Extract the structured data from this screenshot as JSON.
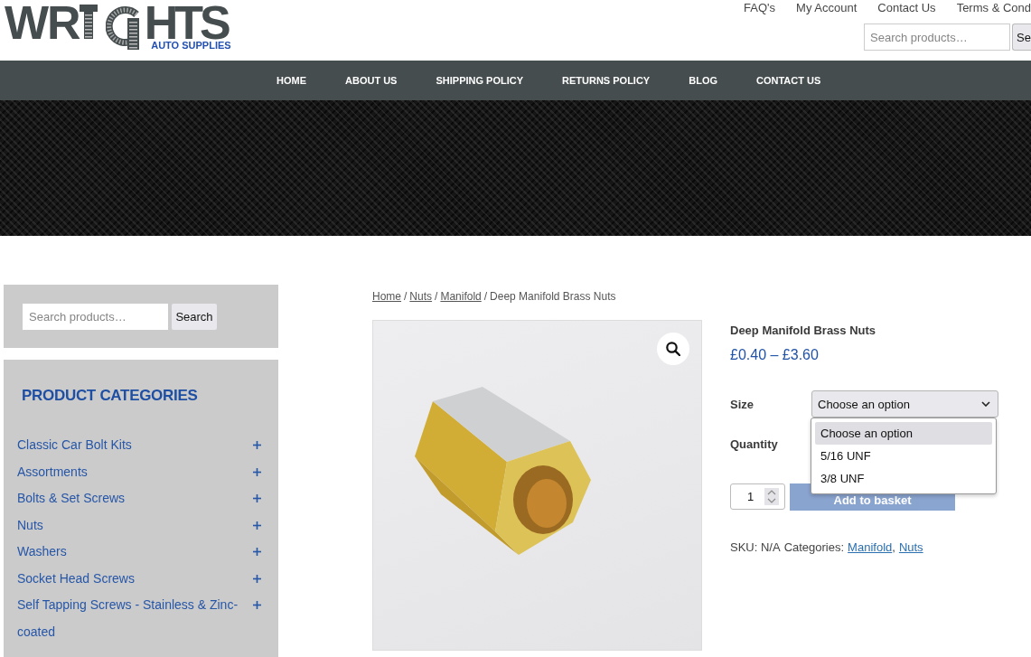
{
  "header": {
    "logo": {
      "text_start": "WR",
      "text_end": "HTS",
      "tagline": "AUTO SUPPLIES"
    },
    "top_links": [
      "FAQ's",
      "My Account",
      "Contact Us",
      "Terms & Cond"
    ],
    "search": {
      "placeholder": "Search products…",
      "button": "Se"
    }
  },
  "nav": [
    "HOME",
    "ABOUT US",
    "SHIPPING POLICY",
    "RETURNS POLICY",
    "BLOG",
    "CONTACT US"
  ],
  "sidebar": {
    "search": {
      "placeholder": "Search products…",
      "button": "Search"
    },
    "categories": {
      "title": "PRODUCT CATEGORIES",
      "items": [
        {
          "label": "Classic Car Bolt Kits",
          "expanded": false
        },
        {
          "label": "Assortments",
          "expanded": false
        },
        {
          "label": "Bolts & Set Screws",
          "expanded": false
        },
        {
          "label": "Nuts",
          "expanded": false
        },
        {
          "label": "Washers",
          "expanded": false
        },
        {
          "label": "Socket Head Screws",
          "expanded": false
        },
        {
          "label": "Self Tapping Screws - Stainless & Zinc-coated",
          "expanded": false
        }
      ]
    }
  },
  "breadcrumb": [
    {
      "label": "Home",
      "kind": "link"
    },
    {
      "label": "/",
      "kind": "separator"
    },
    {
      "label": "Nuts",
      "kind": "link"
    },
    {
      "label": "/",
      "kind": "separator"
    },
    {
      "label": "Manifold",
      "kind": "link"
    },
    {
      "label": "/",
      "kind": "separator"
    },
    {
      "label": "Deep Manifold Brass Nuts",
      "kind": "current"
    }
  ],
  "product": {
    "title": "Deep Manifold Brass Nuts",
    "price": "£0.40 – £3.60",
    "variations": [
      {
        "label": "Size",
        "value": "Choose an option",
        "open": true,
        "options": [
          {
            "label": "Choose an option",
            "selected": true
          },
          {
            "label": "5/16 UNF",
            "selected": false
          },
          {
            "label": "3/8 UNF",
            "selected": false
          }
        ]
      },
      {
        "label": "Quantity"
      }
    ],
    "quantity": "1",
    "add_to_basket": {
      "label": "Add to basket",
      "disabled": true
    },
    "meta": [
      {
        "label": "SKU: N/A",
        "kind": "text"
      },
      {
        "label": "Categories:",
        "kind": "text"
      },
      {
        "label": "Manifold",
        "kind": "link"
      },
      {
        "label": ",",
        "kind": "punct"
      },
      {
        "label": "Nuts",
        "kind": "link"
      }
    ]
  }
}
